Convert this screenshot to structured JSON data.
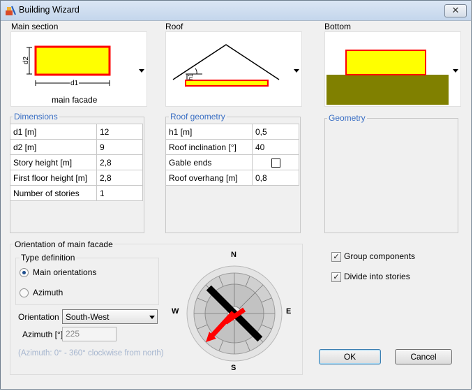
{
  "window": {
    "title": "Building Wizard",
    "close_symbol": "✕"
  },
  "sections": {
    "main": {
      "label": "Main section",
      "caption": "main facade",
      "dim_d1": "d1",
      "dim_d2": "d2"
    },
    "roof": {
      "label": "Roof",
      "dim_h1": "h1"
    },
    "bottom": {
      "label": "Bottom"
    }
  },
  "dimensions": {
    "title": "Dimensions",
    "rows": [
      {
        "label": "d1  [m]",
        "value": "12"
      },
      {
        "label": "d2  [m]",
        "value": "9"
      },
      {
        "label": "Story height  [m]",
        "value": "2,8"
      },
      {
        "label": "First floor height  [m]",
        "value": "2,8"
      },
      {
        "label": "Number of stories",
        "value": "1"
      }
    ]
  },
  "roof_geometry": {
    "title": "Roof geometry",
    "rows": [
      {
        "label": "h1  [m]",
        "value": "0,5"
      },
      {
        "label": "Roof inclination  [°]",
        "value": "40"
      },
      {
        "label": "Gable ends",
        "value": "",
        "checked": false
      },
      {
        "label": "Roof overhang  [m]",
        "value": "0,8"
      }
    ]
  },
  "geometry": {
    "title": "Geometry"
  },
  "orientation": {
    "title": "Orientation of main facade",
    "type_definition": "Type definition",
    "option_main": "Main orientations",
    "option_azimuth": "Azimuth",
    "selected_option": "Main orientations",
    "orientation_label": "Orientation",
    "orientation_value": "South-West",
    "azimuth_label": "Azimuth  [°]",
    "azimuth_value": "225",
    "hint": "(Azimuth: 0° - 360° clockwise from north)"
  },
  "compass": {
    "n": "N",
    "s": "S",
    "e": "E",
    "w": "W",
    "azimuth_deg": 225
  },
  "options": {
    "group_components": {
      "label": "Group components",
      "checked": true
    },
    "divide_stories": {
      "label": "Divide into stories",
      "checked": true
    }
  },
  "buttons": {
    "ok": "OK",
    "cancel": "Cancel"
  },
  "colors": {
    "fill": "#ffff00",
    "outline": "#ff0000",
    "ground": "#808000",
    "link_blue": "#3a6fc4"
  }
}
